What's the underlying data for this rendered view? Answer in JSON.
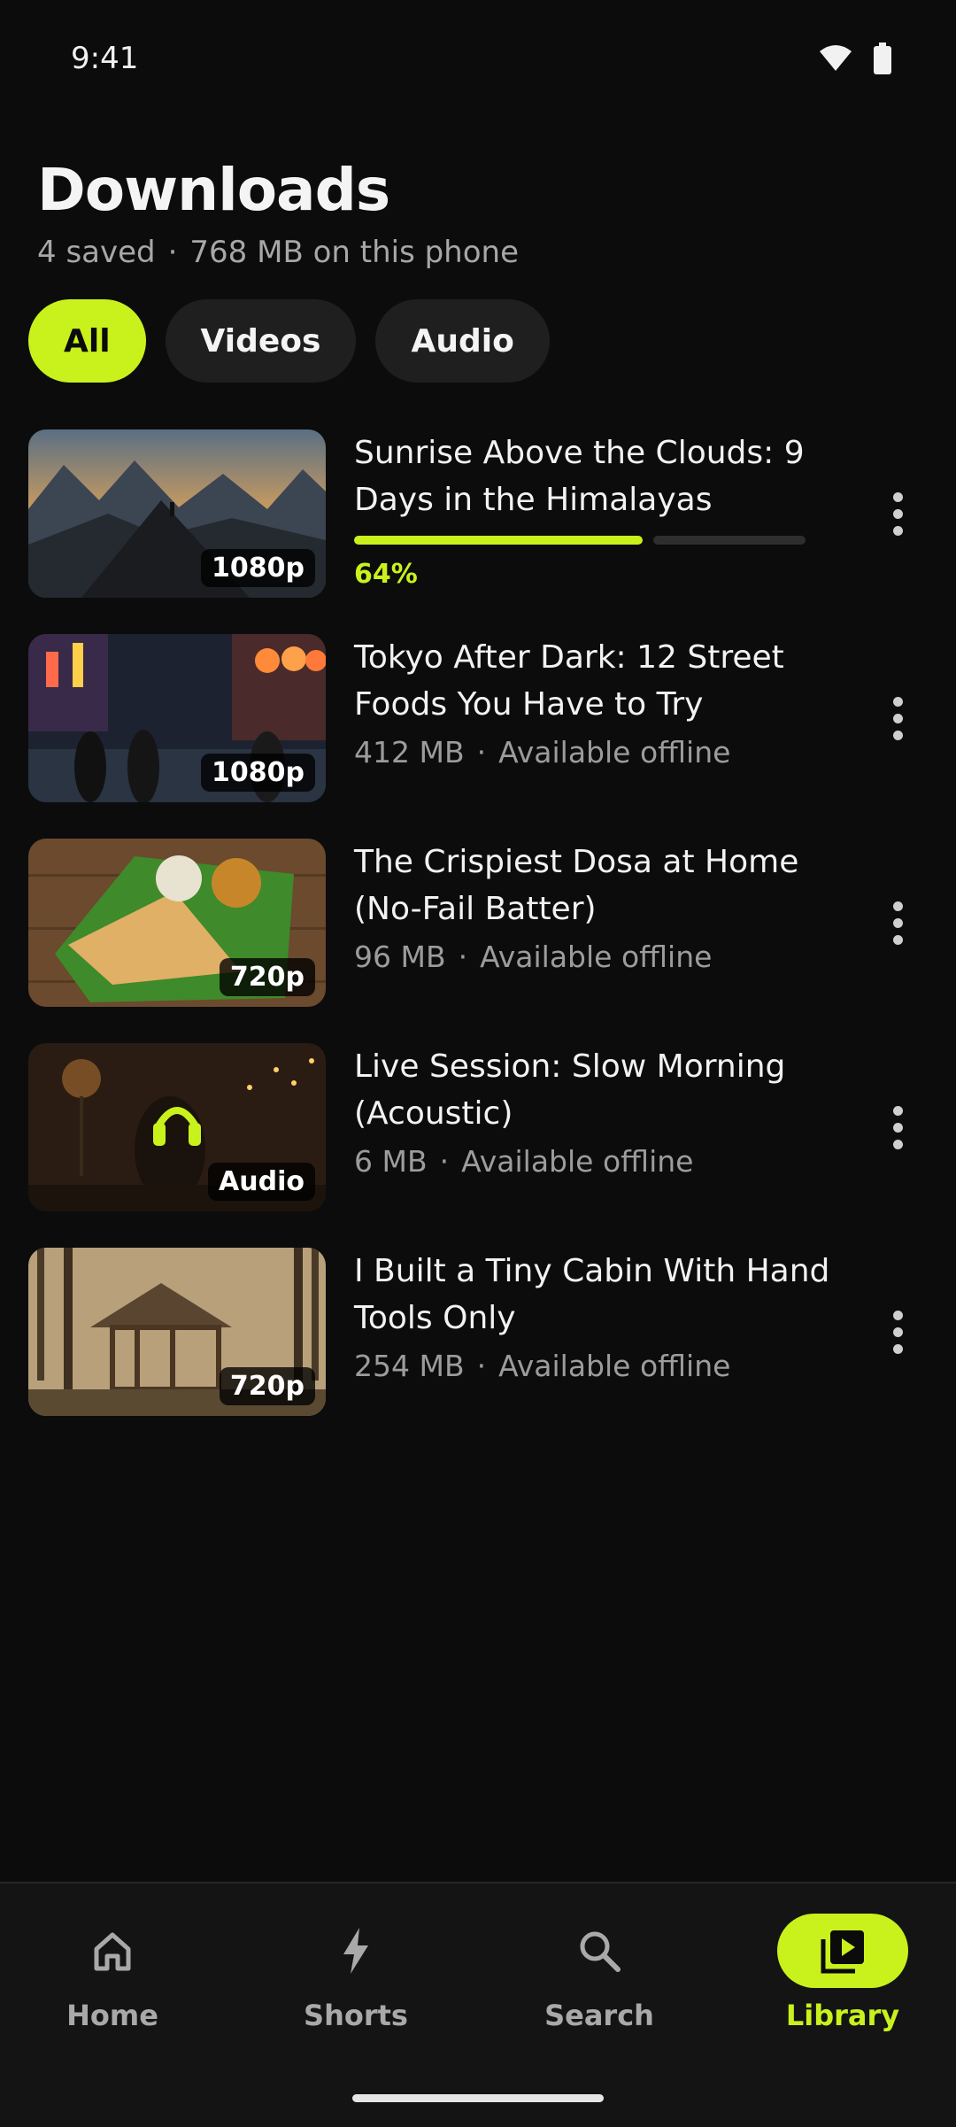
{
  "status": {
    "time": "9:41",
    "icons": [
      "wifi-icon",
      "battery-icon"
    ]
  },
  "header": {
    "title": "Downloads",
    "saved": "4 saved",
    "storage": "768 MB on this phone"
  },
  "filters": [
    {
      "label": "All",
      "active": true
    },
    {
      "label": "Videos",
      "active": false
    },
    {
      "label": "Audio",
      "active": false
    }
  ],
  "items": [
    {
      "title": "Sunrise Above the Clouds: 9 Days in the Himalayas",
      "badge": "1080p",
      "downloading": true,
      "progress": 0.64,
      "progress_label": "64%"
    },
    {
      "title": "Tokyo After Dark: 12 Street Foods You Have to Try",
      "badge": "1080p",
      "size": "412 MB",
      "status": "Available offline"
    },
    {
      "title": "The Crispiest Dosa at Home (No-Fail Batter)",
      "badge": "720p",
      "size": "96 MB",
      "status": "Available offline"
    },
    {
      "title": "Live Session: Slow Morning (Acoustic)",
      "badge": "Audio",
      "size": "6 MB",
      "status": "Available offline"
    },
    {
      "title": "I Built a Tiny Cabin With Hand Tools Only",
      "badge": "720p",
      "size": "254 MB",
      "status": "Available offline"
    }
  ],
  "nav": [
    {
      "label": "Home",
      "icon": "home-icon",
      "active": false
    },
    {
      "label": "Shorts",
      "icon": "bolt-icon",
      "active": false
    },
    {
      "label": "Search",
      "icon": "search-icon",
      "active": false
    },
    {
      "label": "Library",
      "icon": "library-icon",
      "active": true
    }
  ],
  "colors": {
    "accent": "#c9f21c",
    "background": "#0c0c0c"
  }
}
